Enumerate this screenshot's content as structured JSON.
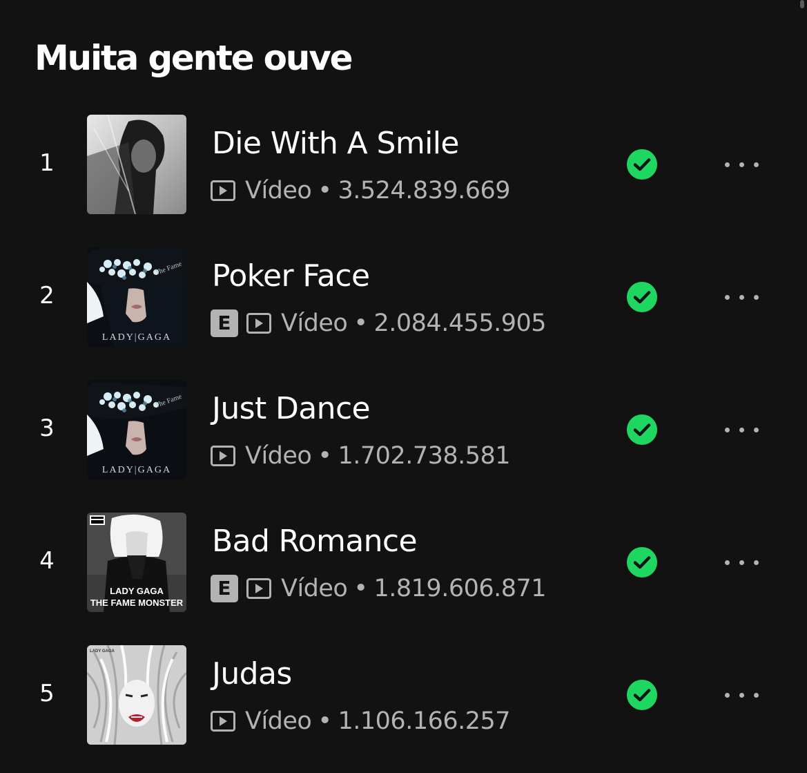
{
  "section": {
    "title": "Muita gente ouve"
  },
  "colors": {
    "background": "#121212",
    "accent": "#1ed760",
    "muted": "#b3b3b3"
  },
  "tracks": [
    {
      "rank": "1",
      "title": "Die With A Smile",
      "explicit": false,
      "type": "Vídeo",
      "separator": "•",
      "plays": "3.524.839.669",
      "cover_text": ""
    },
    {
      "rank": "2",
      "title": "Poker Face",
      "explicit": true,
      "explicit_label": "E",
      "type": "Vídeo",
      "separator": "•",
      "plays": "2.084.455.905",
      "cover_text": "LADY|GAGA"
    },
    {
      "rank": "3",
      "title": "Just Dance",
      "explicit": false,
      "type": "Vídeo",
      "separator": "•",
      "plays": "1.702.738.581",
      "cover_text": "LADY|GAGA"
    },
    {
      "rank": "4",
      "title": "Bad Romance",
      "explicit": true,
      "explicit_label": "E",
      "type": "Vídeo",
      "separator": "•",
      "plays": "1.819.606.871",
      "cover_text": "LADY GAGA",
      "cover_text_2": "THE FAME MONSTER"
    },
    {
      "rank": "5",
      "title": "Judas",
      "explicit": false,
      "type": "Vídeo",
      "separator": "•",
      "plays": "1.106.166.257",
      "cover_text": ""
    }
  ],
  "icons": {
    "video": "video-icon",
    "saved": "check-circle-icon",
    "more": "more-options-icon"
  }
}
